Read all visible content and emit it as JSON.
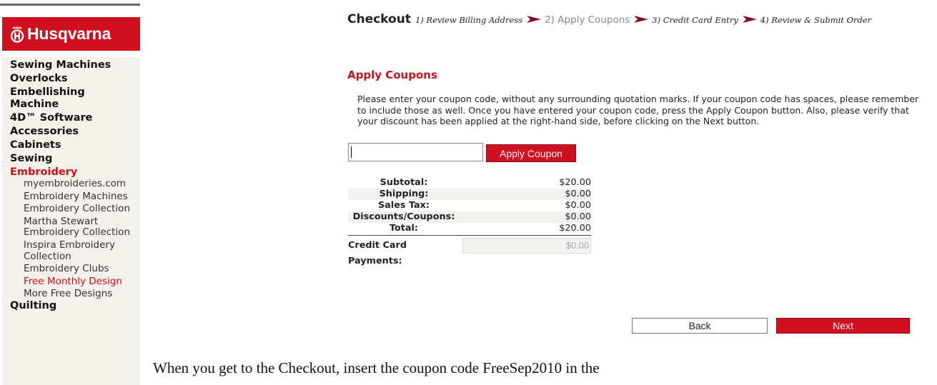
{
  "brand": {
    "name": "Husqvarna",
    "color": "#d0101f"
  },
  "sidebar": {
    "items": [
      {
        "label": "Sewing Machines"
      },
      {
        "label": "Overlocks"
      },
      {
        "label": "Embellishing Machine"
      },
      {
        "label": "4D™ Software"
      },
      {
        "label": "Accessories"
      },
      {
        "label": "Cabinets"
      },
      {
        "label": "Sewing"
      },
      {
        "label": "Embroidery",
        "active": true
      },
      {
        "label": "myembroideries.com",
        "sub": true
      },
      {
        "label": "Embroidery Machines",
        "sub": true
      },
      {
        "label": "Embroidery Collection",
        "sub": true
      },
      {
        "label": "Martha Stewart Embroidery Collection",
        "sub": true
      },
      {
        "label": "Inspira Embroidery Collection",
        "sub": true
      },
      {
        "label": "Embroidery Clubs",
        "sub": true
      },
      {
        "label": "Free Monthly Design",
        "sub": true,
        "active": true
      },
      {
        "label": "More Free Designs",
        "sub": true
      },
      {
        "label": "Quilting"
      }
    ]
  },
  "checkout": {
    "title": "Checkout",
    "steps": [
      {
        "label": "1) Review Billing Address"
      },
      {
        "label": "2) Apply Coupons",
        "current": true
      },
      {
        "label": "3) Credit Card Entry"
      },
      {
        "label": "4) Review & Submit Order"
      }
    ]
  },
  "coupons": {
    "heading": "Apply Coupons",
    "instructions": "Please enter your coupon code, without any surrounding quotation marks. If your coupon code has spaces, please remember to include those as well. Once you have entered your coupon code, press the Apply Coupon button. Also, please verify that your discount has been applied at the right-hand side, before clicking on the Next button.",
    "input_value": "",
    "apply_label": "Apply Coupon"
  },
  "totals": [
    {
      "label": "Subtotal:",
      "value": "$20.00"
    },
    {
      "label": "Shipping:",
      "value": "$0.00"
    },
    {
      "label": "Sales Tax:",
      "value": "$0.00"
    },
    {
      "label": "Discounts/Coupons:",
      "value": "$0.00"
    },
    {
      "label": "Total:",
      "value": "$20.00"
    }
  ],
  "credit_card": {
    "label": "Credit Card Payments:",
    "value": "$0.00"
  },
  "buttons": {
    "back": "Back",
    "next": "Next"
  },
  "footer_text": "When you get to the Checkout, insert the coupon code FreeSep2010 in the",
  "colors": {
    "accent": "#cf1020",
    "nav_bg": "#f3f1e8"
  }
}
